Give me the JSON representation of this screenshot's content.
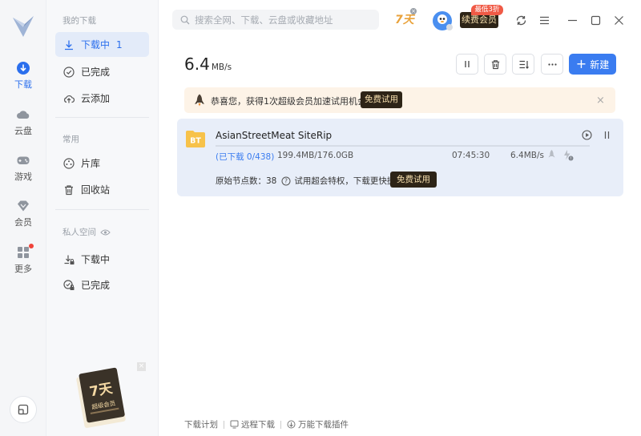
{
  "rail": {
    "items": [
      {
        "label": "下载",
        "icon": "download-icon"
      },
      {
        "label": "云盘",
        "icon": "cloud-icon"
      },
      {
        "label": "游戏",
        "icon": "gamepad-icon"
      },
      {
        "label": "会员",
        "icon": "diamond-icon"
      },
      {
        "label": "更多",
        "icon": "apps-grid-icon"
      }
    ]
  },
  "nav": {
    "section_downloads": "我的下载",
    "downloading": {
      "label": "下载中",
      "count": "1"
    },
    "completed": "已完成",
    "cloud_add": "云添加",
    "section_common": "常用",
    "library": "片库",
    "recycle": "回收站",
    "section_private": "私人空间",
    "private_downloading": "下载中",
    "private_completed": "已完成",
    "promo": {
      "big": "7天",
      "small": "超级会员"
    }
  },
  "header": {
    "search_placeholder": "搜索全网、下载、云盘或收藏地址",
    "badge_7days": "7天",
    "renew_label": "续费会员",
    "renew_tag": "最低3折"
  },
  "toolbar": {
    "speed_value": "6.4",
    "speed_unit": "MB/s",
    "new_label": "新建"
  },
  "banner": {
    "text": "恭喜您，获得1次超级会员加速试用机会!",
    "try_label": "免费试用",
    "close": "×"
  },
  "task": {
    "icon_text": "BT",
    "name": "AsianStreetMeat SiteRip",
    "progress_fraction": 0.0,
    "downloaded": "(已下载 0/438)",
    "size": "199.4MB/176.0GB",
    "time_left": "07:45:30",
    "speed": "6.4MB/s",
    "nodes": "原始节点数：38",
    "trial_text": "试用超会特权，下载更快捷",
    "try_label": "免费试用"
  },
  "footer": {
    "plan": "下载计划",
    "remote": "远程下载",
    "plugin": "万能下载插件"
  },
  "colors": {
    "accent": "#3a7cf0",
    "vip_dark": "#2d2417",
    "vip_gold": "#f6dfae",
    "tag_red": "#f05a46"
  }
}
